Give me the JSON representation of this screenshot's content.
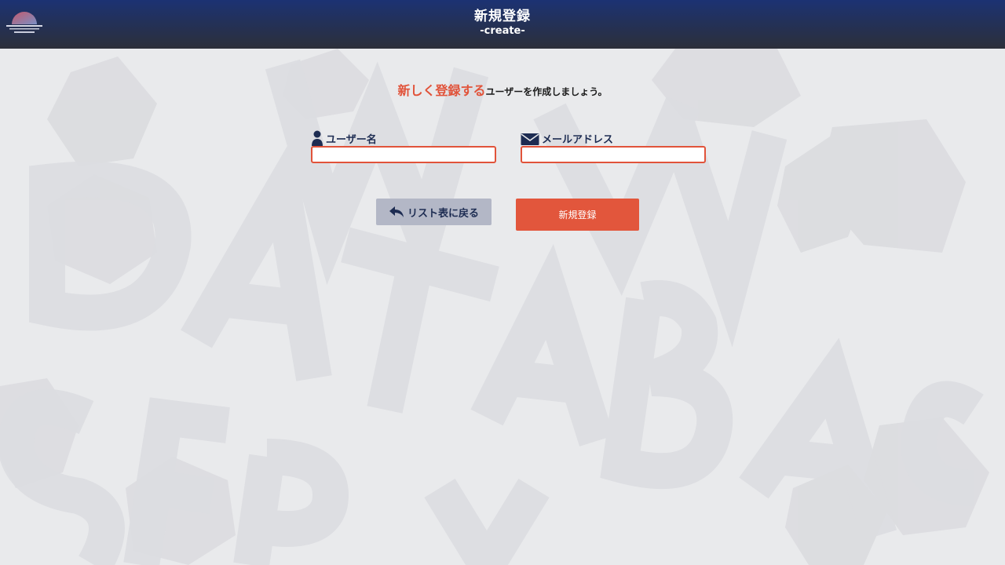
{
  "header": {
    "title": "新規登録",
    "subtitle": "-create-"
  },
  "main": {
    "lead_accent": "新しく登録する",
    "lead_rest": "ユーザーを作成しましょう。"
  },
  "form": {
    "username": {
      "label": "ユーザー名",
      "value": "",
      "placeholder": ""
    },
    "email": {
      "label": "メールアドレス",
      "value": "",
      "placeholder": ""
    }
  },
  "actions": {
    "back_label": "リスト表に戻る",
    "submit_label": "新規登録"
  },
  "colors": {
    "accent": "#e1533a",
    "navy": "#1d2c52",
    "header_top": "#1c3273",
    "header_bottom": "#2c2f3a",
    "back_button": "#b3b7c6"
  },
  "icons": {
    "username": "user-icon",
    "email": "envelope-icon",
    "back": "reply-arrow-icon"
  }
}
